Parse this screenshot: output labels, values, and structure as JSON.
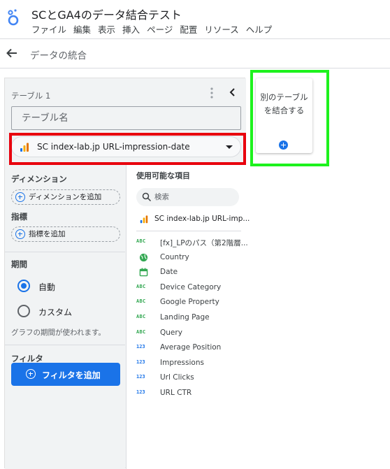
{
  "app": {
    "title": "SCとGA4のデータ結合テスト",
    "menu": [
      "ファイル",
      "編集",
      "表示",
      "挿入",
      "ページ",
      "配置",
      "リソース",
      "ヘルプ"
    ]
  },
  "subheader": {
    "title": "データの統合"
  },
  "table": {
    "label": "テーブル 1",
    "name_placeholder": "テーブル名",
    "source": "SC index-lab.jp URL-impression-date"
  },
  "left": {
    "dimension_title": "ディメンション",
    "add_dimension": "ディメンションを追加",
    "metric_title": "指標",
    "add_metric": "指標を追加",
    "period_title": "期間",
    "period_auto": "自動",
    "period_custom": "カスタム",
    "period_note": "グラフの期間が使われます。",
    "filter_title": "フィルタ",
    "add_filter": "フィルタを追加"
  },
  "fields": {
    "title": "使用可能な項目",
    "search_placeholder": "検索",
    "source_item": "SC index-lab.jp URL-imp...",
    "items": [
      {
        "type": "ABC",
        "label": "[fx]_LPのパス（第2階層..."
      },
      {
        "type": "geo",
        "label": "Country"
      },
      {
        "type": "date",
        "label": "Date"
      },
      {
        "type": "ABC",
        "label": "Device Category"
      },
      {
        "type": "ABC",
        "label": "Google Property"
      },
      {
        "type": "ABC",
        "label": "Landing Page"
      },
      {
        "type": "ABC",
        "label": "Query"
      },
      {
        "type": "123",
        "label": "Average Position"
      },
      {
        "type": "123",
        "label": "Impressions"
      },
      {
        "type": "123",
        "label": "Url Clicks"
      },
      {
        "type": "123",
        "label": "URL CTR"
      }
    ]
  },
  "add_table_card": {
    "label": "別のテーブルを結合する"
  },
  "colors": {
    "accent": "#1a73e8",
    "highlight_red": "#e8000d",
    "highlight_green": "#1df21d"
  }
}
